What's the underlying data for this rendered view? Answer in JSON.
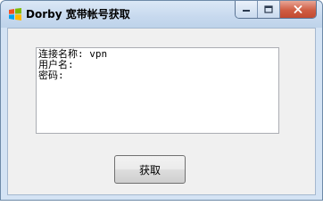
{
  "window": {
    "title": "Dorby 宽带帐号获取"
  },
  "output": {
    "lines": [
      "连接名称: vpn",
      "用户名:",
      "密码:"
    ]
  },
  "buttons": {
    "fetch_label": "获取"
  },
  "colors": {
    "titlebar": "#c7d9ee",
    "client_bg": "#f0f0f0",
    "close_button": "#cf5d43"
  }
}
